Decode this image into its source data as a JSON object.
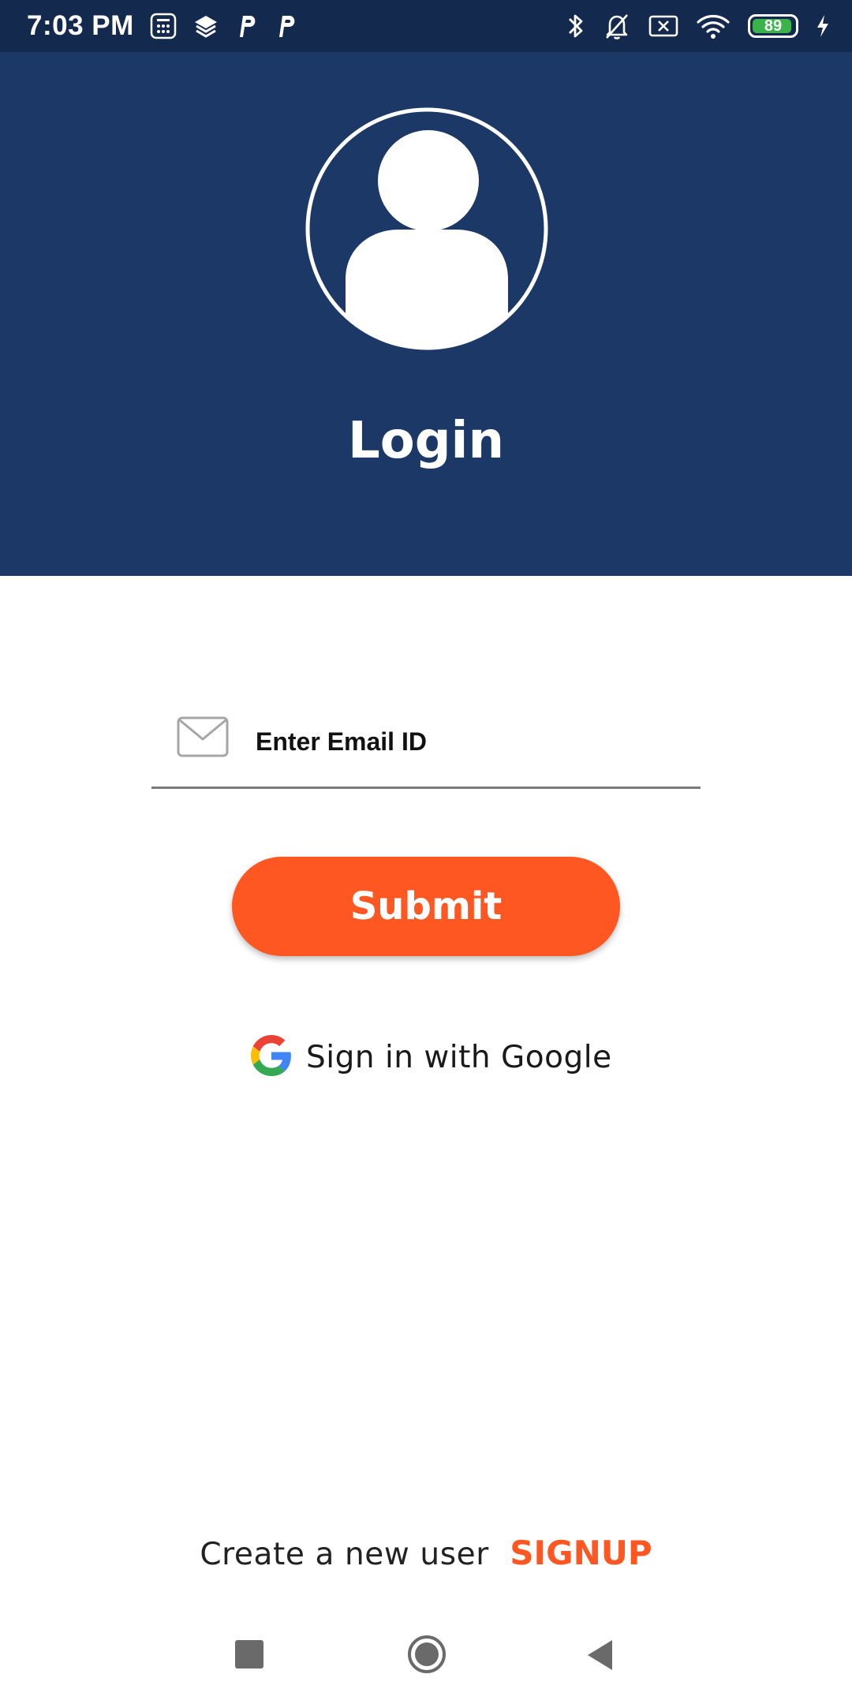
{
  "status_bar": {
    "time": "7:03 PM",
    "battery_level": "89",
    "left_icons": [
      "calculator-icon",
      "layers-icon",
      "parking-p-icon",
      "parking-p-icon"
    ],
    "right_icons": [
      "bluetooth-icon",
      "bell-off-icon",
      "sim-x-icon",
      "wifi-icon",
      "battery-icon",
      "charging-bolt-icon"
    ]
  },
  "header": {
    "title": "Login",
    "background_color": "#1b3867",
    "avatar_icon": "user-avatar-icon"
  },
  "login_form": {
    "email_placeholder": "Enter Email ID",
    "email_value": "",
    "email_icon": "mail-icon",
    "submit_label": "Submit",
    "submit_color": "#ff5722"
  },
  "google_signin": {
    "icon": "google-logo-icon",
    "label": "Sign in with Google"
  },
  "signup": {
    "prompt": "Create a new user",
    "link_label": "SIGNUP",
    "link_color": "#ff5722"
  },
  "nav_bar": {
    "icons": [
      "recent-apps-icon",
      "home-icon",
      "back-icon"
    ]
  }
}
